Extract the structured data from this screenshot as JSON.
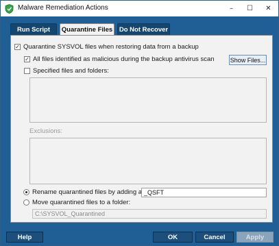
{
  "window": {
    "title": "Malware Remediation Actions",
    "minimize": "–",
    "maximize": "☐",
    "close": "✕"
  },
  "tabs": [
    {
      "label": "Run Script"
    },
    {
      "label": "Quarantine Files"
    },
    {
      "label": "Do Not Recover"
    }
  ],
  "options": {
    "quarantine_sysvol": {
      "label": "Quarantine SYSVOL files when restoring data from a backup",
      "checked": true
    },
    "all_malicious": {
      "label": "All files identified as malicious during the backup antivirus scan",
      "checked": true
    },
    "specified": {
      "label": "Specified files and folders:",
      "checked": false
    },
    "show_files_label": "Show Files...",
    "exclusions_label": "Exclusions:",
    "rename_label": "Rename quarantined files by adding a suffix:",
    "suffix_value": "_QSFT",
    "move_label": "Move quarantined files to a folder:",
    "folder_value": "C:\\SYSVOL_Quarantined"
  },
  "footer": {
    "help": "Help",
    "ok": "OK",
    "cancel": "Cancel",
    "apply": "Apply"
  },
  "colors": {
    "accent": "#1f5f95",
    "button": "#1c4f7c"
  }
}
